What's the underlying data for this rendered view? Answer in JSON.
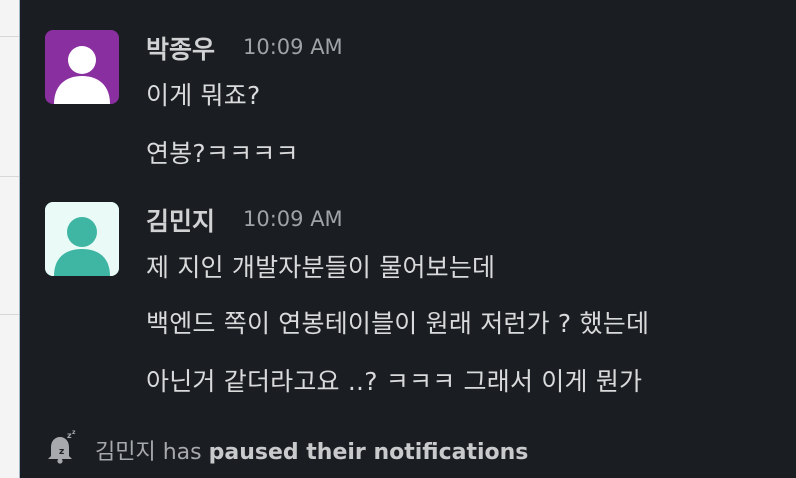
{
  "messages": [
    {
      "user": "박종우",
      "time": "10:09 AM",
      "avatar_color": "#8a2fa0",
      "lines": [
        "이게 뭐죠?",
        "연봉?ㅋㅋㅋㅋ"
      ]
    },
    {
      "user": "김민지",
      "time": "10:09 AM",
      "avatar_color": "#3fb5a3",
      "lines": [
        "제 지인 개발자분들이 물어보는데",
        "백엔드 쪽이 연봉테이블이 원래 저런가 ? 했는데",
        "아닌거 같더라고요 ..? ㅋㅋㅋ 그래서 이게 뭔가"
      ]
    }
  ],
  "status_bar": {
    "icon": "paused-notifications-icon",
    "user": "김민지",
    "middle": " has ",
    "bold": "paused their notifications"
  }
}
